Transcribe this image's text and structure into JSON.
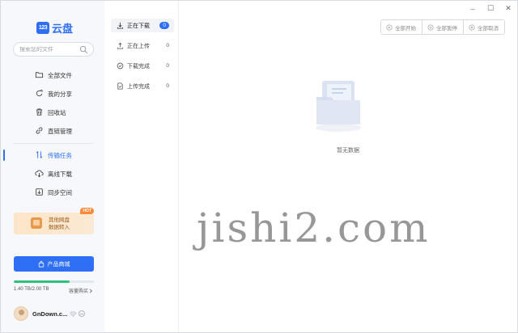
{
  "app": {
    "logo_mark": "123",
    "logo_text": "云盘"
  },
  "search": {
    "placeholder": "搜索您的文件",
    "icon": "search-icon"
  },
  "sidebar": {
    "items": [
      {
        "label": "全部文件",
        "icon": "folder-icon"
      },
      {
        "label": "我的分享",
        "icon": "share-icon"
      },
      {
        "label": "回收站",
        "icon": "trash-icon"
      },
      {
        "label": "直链管理",
        "icon": "link-icon"
      },
      {
        "label": "传输任务",
        "icon": "transfer-icon",
        "active": true
      },
      {
        "label": "离线下载",
        "icon": "cloud-download-icon"
      },
      {
        "label": "同步空间",
        "icon": "sync-icon"
      }
    ],
    "promo": {
      "line1": "其他网盘",
      "line2": "数据转入",
      "badge": "HOT"
    },
    "store_button": "产品商城",
    "quota": {
      "text": "1.40 TB/2.00 TB",
      "used_fraction": 0.7,
      "upgrade": "容量购买"
    },
    "user": {
      "name": "GnDown.c..."
    }
  },
  "tasks": {
    "items": [
      {
        "label": "正在下载",
        "count": "0",
        "active": true
      },
      {
        "label": "正在上传",
        "count": "0"
      },
      {
        "label": "下载完成",
        "count": "0"
      },
      {
        "label": "上传完成",
        "count": "0"
      }
    ]
  },
  "window": {
    "minimize": "–",
    "maximize": "☐",
    "close": "✕"
  },
  "toolbar": {
    "start_all": "全部开始",
    "pause_all": "全部暂停",
    "cancel_all": "全部取消"
  },
  "main": {
    "empty_text": "暂无数据"
  },
  "watermark": "jishi2.com",
  "colors": {
    "accent": "#2e6ff5",
    "quota_fill": "#2ec27e",
    "hot_badge": "#ff8a3a"
  }
}
